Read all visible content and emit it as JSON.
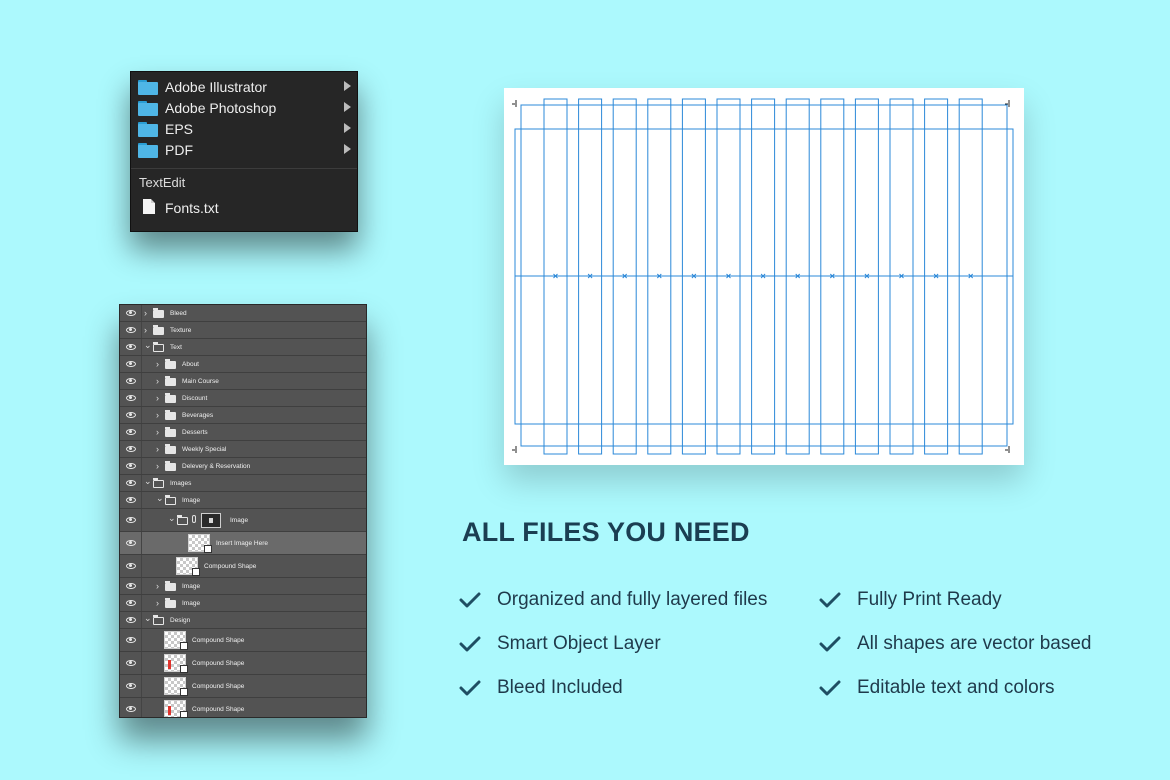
{
  "files_menu": {
    "folders": [
      {
        "label": "Adobe Illustrator"
      },
      {
        "label": "Adobe Photoshop"
      },
      {
        "label": "EPS"
      },
      {
        "label": "PDF"
      }
    ],
    "section_label": "TextEdit",
    "file": {
      "label": "Fonts.txt",
      "icon": "text-file-icon"
    }
  },
  "layers": [
    {
      "label": "Bleed"
    },
    {
      "label": "Texture"
    },
    {
      "label": "Text"
    },
    {
      "label": "About"
    },
    {
      "label": "Main Course"
    },
    {
      "label": "Discount"
    },
    {
      "label": "Beverages"
    },
    {
      "label": "Desserts"
    },
    {
      "label": "Weekly Special"
    },
    {
      "label": "Delevery & Reservation"
    },
    {
      "label": "Images"
    },
    {
      "label": "Image"
    },
    {
      "label": "Image"
    },
    {
      "label": "Insert Image Here"
    },
    {
      "label": "Compound Shape"
    },
    {
      "label": "Image"
    },
    {
      "label": "Image"
    },
    {
      "label": "Design"
    },
    {
      "label": "Compound Shape"
    },
    {
      "label": "Compound Shape"
    },
    {
      "label": "Compound Shape"
    },
    {
      "label": "Compound Shape"
    }
  ],
  "features": {
    "heading": "ALL FILES YOU NEED",
    "items": [
      "Organized and fully layered files",
      "Smart Object Layer",
      "Bleed Included",
      "Fully Print Ready",
      "All shapes are vector based",
      "Editable text and colors"
    ],
    "check_icon": "check-icon"
  },
  "colors": {
    "background": "#acf9fd",
    "heading": "#1b3e52",
    "check": "#1f4e63",
    "guide": "#2b88d8",
    "folder": "#4fb6e6"
  }
}
